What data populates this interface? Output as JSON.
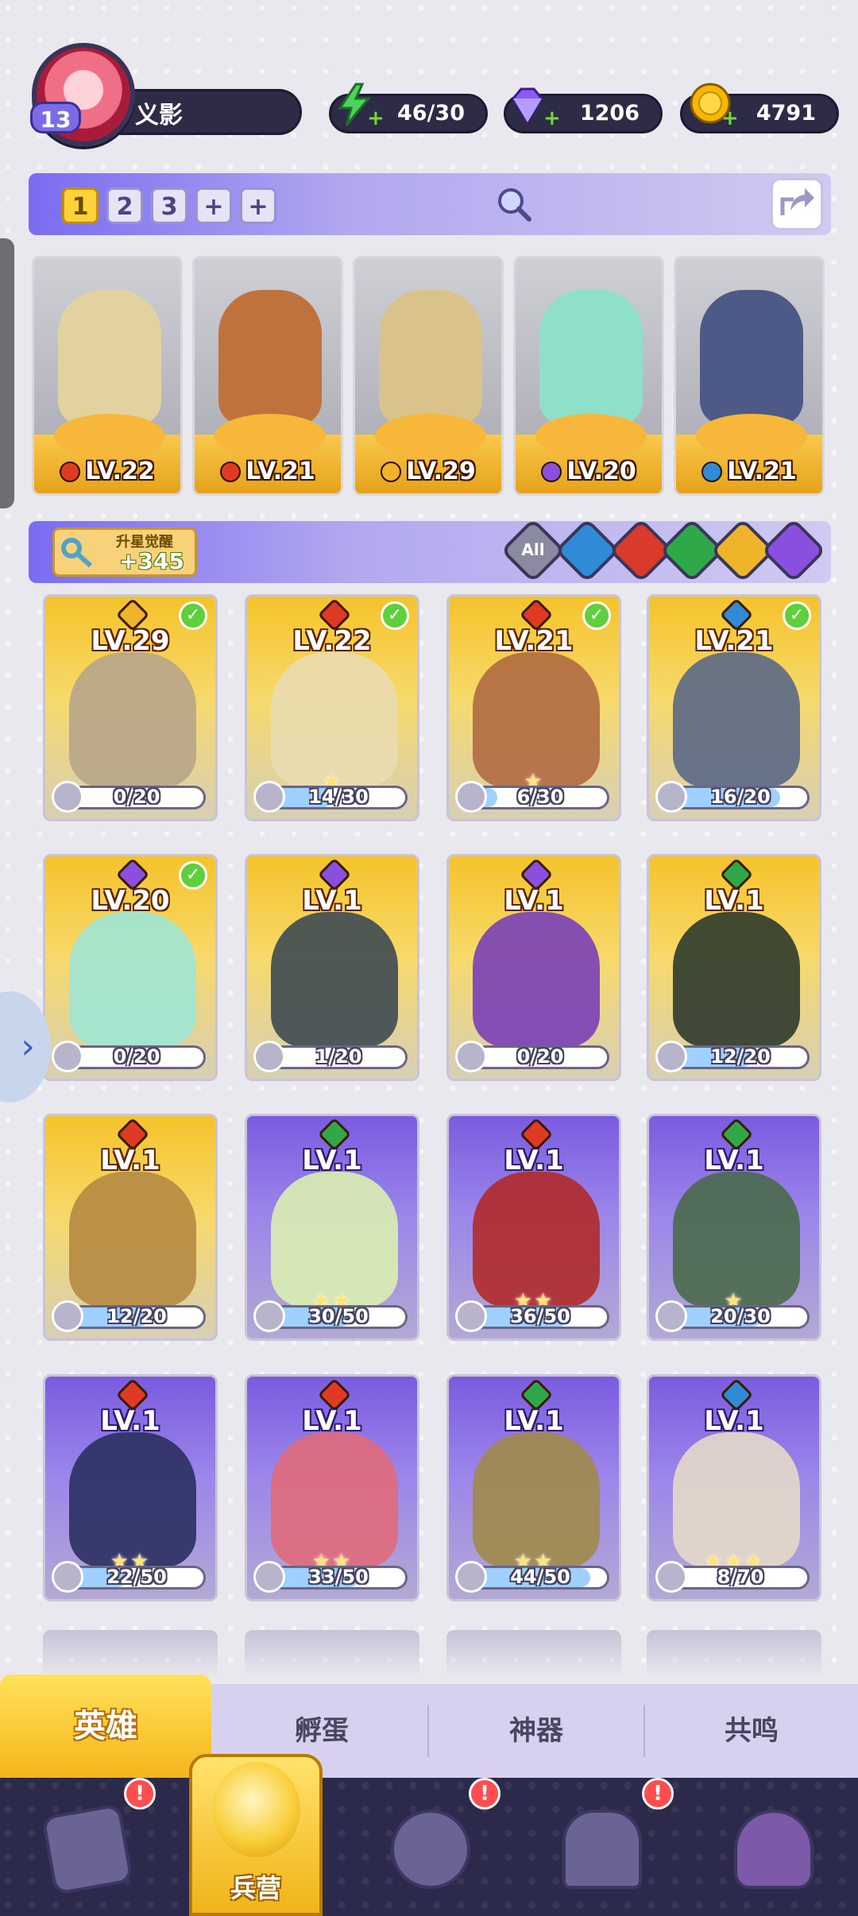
{
  "player": {
    "name": "义影",
    "level": "13"
  },
  "resources": {
    "energy": {
      "icon": "lightning-icon",
      "value": "46/30",
      "color": "#4cd35c"
    },
    "gems": {
      "icon": "diamond-icon",
      "value": "1206",
      "color": "#8a5cf0"
    },
    "coins": {
      "icon": "coin-icon",
      "value": "4791",
      "color": "#f5b800"
    }
  },
  "team_slots": [
    "1",
    "2",
    "3",
    "+",
    "+"
  ],
  "active_team_slot": "1",
  "lineup": [
    {
      "level": "LV.22",
      "element": "fire",
      "color": "#e2d2a0"
    },
    {
      "level": "LV.21",
      "element": "fire",
      "color": "#c0723d"
    },
    {
      "level": "LV.29",
      "element": "light",
      "color": "#d9c38a"
    },
    {
      "level": "LV.20",
      "element": "dark",
      "color": "#8fe0c9"
    },
    {
      "level": "LV.21",
      "element": "water",
      "color": "#4d5a88"
    }
  ],
  "awaken": {
    "title": "升星觉醒",
    "value": "+345"
  },
  "filters": [
    {
      "label": "All",
      "color": "#8a8aa0"
    },
    {
      "label": "",
      "color": "#2f8bd6"
    },
    {
      "label": "",
      "color": "#d93a2a"
    },
    {
      "label": "",
      "color": "#2fa84a"
    },
    {
      "label": "",
      "color": "#f0b42a"
    },
    {
      "label": "",
      "color": "#8b4fe0"
    }
  ],
  "element_colors": {
    "fire": "#e03a24",
    "water": "#2f8bd6",
    "nature": "#2fa84a",
    "light": "#f0b42a",
    "dark": "#8b4fe0"
  },
  "heroes": [
    {
      "level": "LV.29",
      "element": "light",
      "shards": "0/20",
      "progress": 0.0,
      "owned": true,
      "style": "gold",
      "stars": "",
      "art": "#b7a58a"
    },
    {
      "level": "LV.22",
      "element": "fire",
      "shards": "14/30",
      "progress": 0.47,
      "owned": true,
      "style": "gold",
      "stars": "★",
      "art": "#e9dcb0"
    },
    {
      "level": "LV.21",
      "element": "fire",
      "shards": "6/30",
      "progress": 0.2,
      "owned": true,
      "style": "gold",
      "stars": "★",
      "art": "#b06a42"
    },
    {
      "level": "LV.21",
      "element": "water",
      "shards": "16/20",
      "progress": 0.8,
      "owned": true,
      "style": "gold",
      "stars": "",
      "art": "#5a6886"
    },
    {
      "level": "LV.20",
      "element": "dark",
      "shards": "0/20",
      "progress": 0.0,
      "owned": true,
      "style": "gold",
      "stars": "",
      "art": "#9fe6d4"
    },
    {
      "level": "LV.1",
      "element": "dark",
      "shards": "1/20",
      "progress": 0.05,
      "owned": false,
      "style": "gold",
      "stars": "",
      "art": "#3d4a52"
    },
    {
      "level": "LV.1",
      "element": "dark",
      "shards": "0/20",
      "progress": 0.0,
      "owned": false,
      "style": "gold",
      "stars": "",
      "art": "#7a3fb8"
    },
    {
      "level": "LV.1",
      "element": "nature",
      "shards": "12/20",
      "progress": 0.6,
      "owned": false,
      "style": "gold",
      "stars": "",
      "art": "#2e3a2e"
    },
    {
      "level": "LV.1",
      "element": "fire",
      "shards": "12/20",
      "progress": 0.6,
      "owned": false,
      "style": "gold",
      "stars": "",
      "art": "#b58a42"
    },
    {
      "level": "LV.1",
      "element": "nature",
      "shards": "30/50",
      "progress": 0.6,
      "owned": false,
      "style": "purple",
      "stars": "★★",
      "art": "#d9f0b0"
    },
    {
      "level": "LV.1",
      "element": "fire",
      "shards": "36/50",
      "progress": 0.72,
      "owned": false,
      "style": "purple",
      "stars": "★★",
      "art": "#b02a2a"
    },
    {
      "level": "LV.1",
      "element": "nature",
      "shards": "20/30",
      "progress": 0.67,
      "owned": false,
      "style": "purple",
      "stars": "★",
      "art": "#4a6a4a"
    },
    {
      "level": "LV.1",
      "element": "fire",
      "shards": "22/50",
      "progress": 0.44,
      "owned": false,
      "style": "purple",
      "stars": "★★",
      "art": "#2a3060"
    },
    {
      "level": "LV.1",
      "element": "fire",
      "shards": "33/50",
      "progress": 0.66,
      "owned": false,
      "style": "purple",
      "stars": "★★",
      "art": "#e06a7a"
    },
    {
      "level": "LV.1",
      "element": "nature",
      "shards": "44/50",
      "progress": 0.88,
      "owned": false,
      "style": "purple",
      "stars": "★★",
      "art": "#a08a4a"
    },
    {
      "level": "LV.1",
      "element": "water",
      "shards": "8/70",
      "progress": 0.11,
      "owned": false,
      "style": "purple",
      "stars": "★★★",
      "art": "#e6d9c8"
    }
  ],
  "sub_tabs": [
    {
      "label": "英雄",
      "active": true
    },
    {
      "label": "孵蛋",
      "active": false
    },
    {
      "label": "神器",
      "active": false
    },
    {
      "label": "共鸣",
      "active": false
    }
  ],
  "bottom_nav": [
    {
      "label": "",
      "icon": "cards-icon",
      "badge": "!"
    },
    {
      "label": "兵营",
      "icon": "barracks-fist-icon",
      "badge": ""
    },
    {
      "label": "",
      "icon": "map-book-icon",
      "badge": "!"
    },
    {
      "label": "",
      "icon": "castle-icon",
      "badge": "!"
    },
    {
      "label": "",
      "icon": "mushroom-house-icon",
      "badge": ""
    }
  ]
}
